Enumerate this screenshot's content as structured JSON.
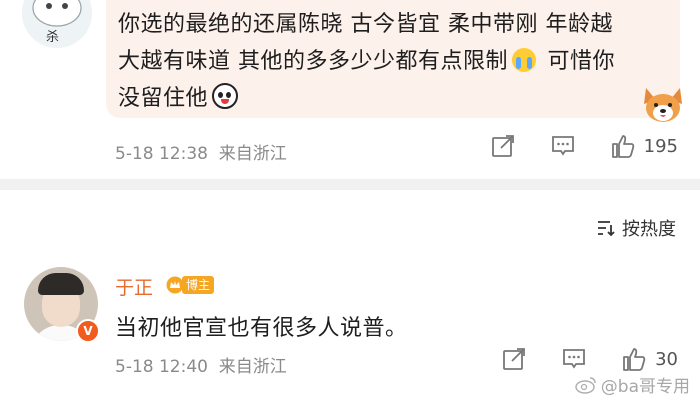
{
  "comment1": {
    "text_lines": [
      "你选的最绝的还属陈晓 古今皆宜 柔中带刚 年龄越",
      "大越有味道 其他的多多少少都有点限制",
      "可惜你",
      "没留住他"
    ],
    "emoji_cry": "cry-emoji",
    "emoji_panda": "panda-emoji",
    "avatar_glyph": "杀",
    "time": "5-18 12:38",
    "location": "来自浙江",
    "likes": "195"
  },
  "sort": {
    "label": "按热度"
  },
  "comment2": {
    "name": "于正",
    "badge": "博主",
    "text": "当初他官宣也有很多人说普。",
    "verified_mark": "V",
    "time": "5-18 12:40",
    "location": "来自浙江",
    "likes": "30"
  },
  "watermark": {
    "text": "@ba哥专用"
  },
  "colors": {
    "bubble_bg": "#fdf1ec",
    "name_orange": "#e96a2e",
    "meta_gray": "#8a8a8a",
    "divider": "#f1f1f1",
    "badge_gold": "#f5a623",
    "verified_orange": "#f25a1e"
  },
  "icons": [
    "share-icon",
    "comment-icon",
    "like-icon",
    "sort-icon",
    "crown-icon",
    "corgi-sticker",
    "weibo-logo-icon"
  ]
}
